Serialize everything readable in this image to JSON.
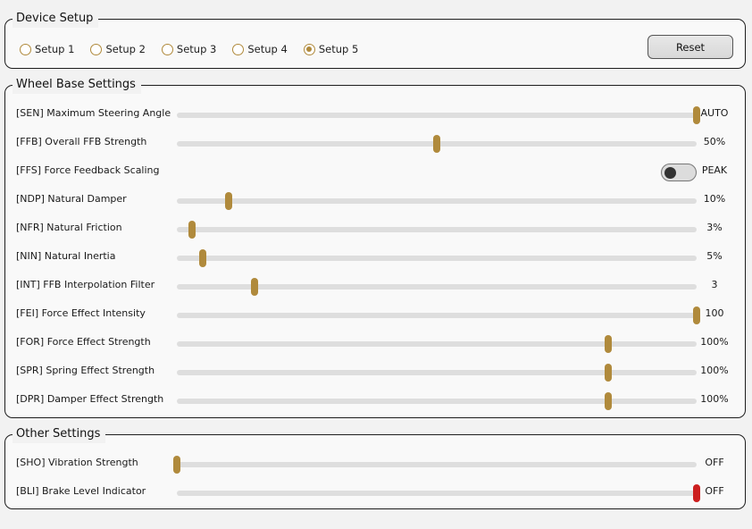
{
  "device_setup": {
    "title": "Device Setup",
    "options": [
      "Setup 1",
      "Setup 2",
      "Setup 3",
      "Setup 4",
      "Setup 5"
    ],
    "selected_index": 4,
    "reset_label": "Reset"
  },
  "wheel_base": {
    "title": "Wheel Base Settings",
    "rows": [
      {
        "label": "[SEN] Maximum Steering Angle",
        "value": "AUTO",
        "level": 1.0,
        "kind": "slider"
      },
      {
        "label": "[FFB] Overall FFB Strength",
        "value": "50%",
        "level": 0.5,
        "kind": "slider"
      },
      {
        "label": "[FFS] Force Feedback Scaling",
        "value": "PEAK",
        "level": 0,
        "kind": "toggle"
      },
      {
        "label": "[NDP] Natural Damper",
        "value": "10%",
        "level": 0.1,
        "kind": "slider"
      },
      {
        "label": "[NFR] Natural Friction",
        "value": "3%",
        "level": 0.03,
        "kind": "slider"
      },
      {
        "label": "[NIN] Natural Inertia",
        "value": "5%",
        "level": 0.05,
        "kind": "slider"
      },
      {
        "label": "[INT] FFB Interpolation Filter",
        "value": "3",
        "level": 0.15,
        "kind": "slider"
      },
      {
        "label": "[FEI] Force Effect Intensity",
        "value": "100",
        "level": 1.0,
        "kind": "slider"
      },
      {
        "label": "[FOR] Force Effect Strength",
        "value": "100%",
        "level": 0.83,
        "kind": "slider"
      },
      {
        "label": "[SPR] Spring Effect Strength",
        "value": "100%",
        "level": 0.83,
        "kind": "slider"
      },
      {
        "label": "[DPR] Damper Effect Strength",
        "value": "100%",
        "level": 0.83,
        "kind": "slider"
      }
    ]
  },
  "other": {
    "title": "Other Settings",
    "rows": [
      {
        "label": "[SHO] Vibration Strength",
        "value": "OFF",
        "level": 0.0,
        "kind": "slider"
      },
      {
        "label": "[BLI] Brake Level Indicator",
        "value": "OFF",
        "level": 1.0,
        "kind": "slider",
        "thumb_color": "#cc1f1f"
      }
    ]
  },
  "colors": {
    "accent": "#b08a3c",
    "warning": "#cc1f1f",
    "track": "#dedede"
  }
}
